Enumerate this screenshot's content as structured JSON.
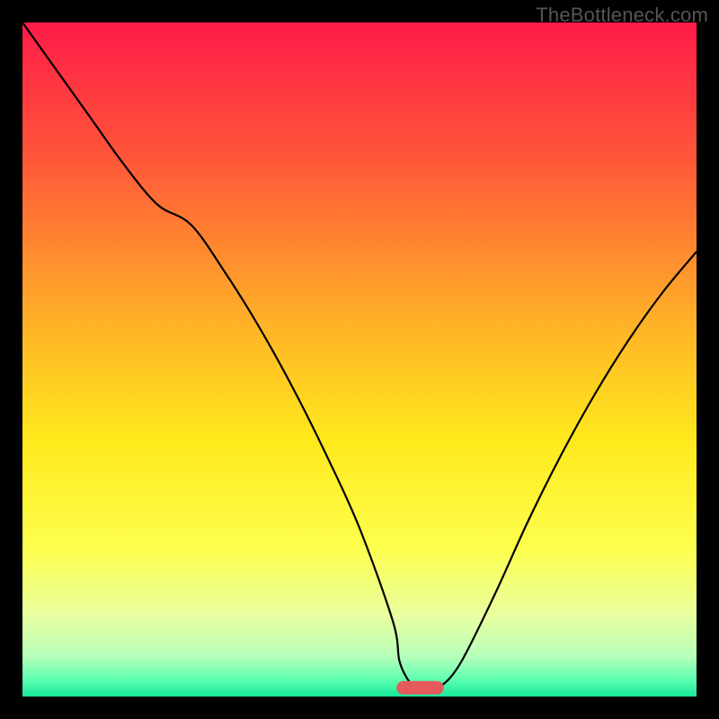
{
  "watermark": "TheBottleneck.com",
  "chart_data": {
    "type": "line",
    "title": "",
    "xlabel": "",
    "ylabel": "",
    "xlim": [
      0,
      100
    ],
    "ylim": [
      0,
      100
    ],
    "grid": false,
    "legend": false,
    "background_gradient_stops": [
      {
        "offset": 0.0,
        "color": "#ff1b49"
      },
      {
        "offset": 0.2,
        "color": "#ff5639"
      },
      {
        "offset": 0.45,
        "color": "#ffb327"
      },
      {
        "offset": 0.62,
        "color": "#ffe91c"
      },
      {
        "offset": 0.78,
        "color": "#fdff4e"
      },
      {
        "offset": 0.88,
        "color": "#e9ffa0"
      },
      {
        "offset": 0.94,
        "color": "#b8ffba"
      },
      {
        "offset": 0.975,
        "color": "#5dffb0"
      },
      {
        "offset": 1.0,
        "color": "#17e89a"
      }
    ],
    "series": [
      {
        "name": "bottleneck-curve",
        "color": "#000000",
        "x": [
          0,
          5,
          10,
          15,
          20,
          25,
          30,
          35,
          40,
          45,
          50,
          55,
          56,
          58,
          60,
          62,
          65,
          70,
          75,
          80,
          85,
          90,
          95,
          100
        ],
        "y": [
          100,
          93,
          86,
          79,
          73,
          70,
          63,
          55,
          46,
          36,
          25,
          11,
          5,
          1.5,
          1.3,
          1.5,
          5,
          15,
          26,
          36,
          45,
          53,
          60,
          66
        ]
      }
    ],
    "marker": {
      "name": "optimal-range-marker",
      "color": "#e55a5a",
      "x_center": 59,
      "width": 7,
      "y": 1.3,
      "height": 2.0
    }
  }
}
